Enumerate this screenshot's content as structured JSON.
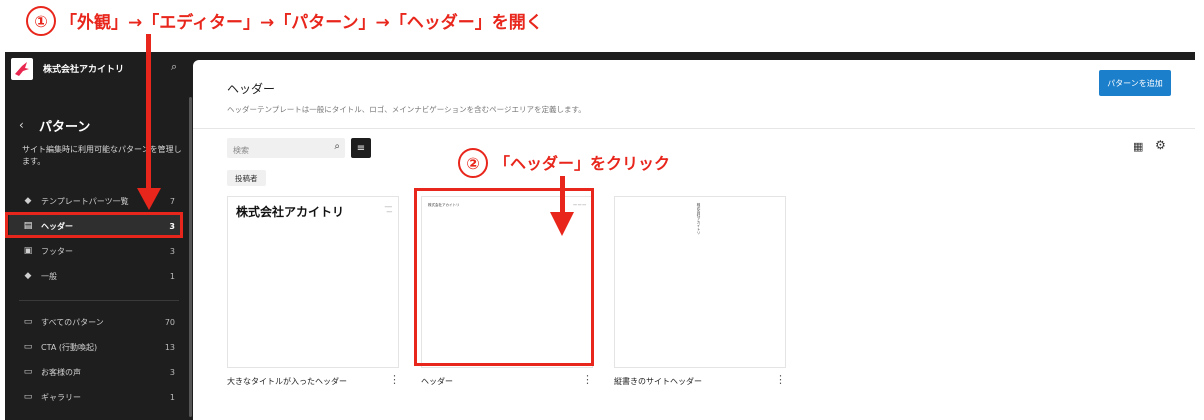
{
  "annotations": {
    "step1_number": "①",
    "step1_text": "「外観」→「エディター」→「パターン」→「ヘッダー」を開く",
    "step2_number": "②",
    "step2_text": "「ヘッダー」をクリック"
  },
  "sidebar": {
    "site_name": "株式会社アカイトリ",
    "title": "パターン",
    "description": "サイト編集時に利用可能なパターンを管理します。",
    "items": [
      {
        "label": "テンプレートパーツ一覧",
        "count": "7",
        "icon": "template-parts-icon"
      },
      {
        "label": "ヘッダー",
        "count": "3",
        "icon": "header-icon",
        "active": true
      },
      {
        "label": "フッター",
        "count": "3",
        "icon": "footer-icon"
      },
      {
        "label": "一般",
        "count": "1",
        "icon": "general-icon"
      }
    ],
    "categories": [
      {
        "label": "すべてのパターン",
        "count": "70"
      },
      {
        "label": "CTA (行動喚起)",
        "count": "13"
      },
      {
        "label": "お客様の声",
        "count": "3"
      },
      {
        "label": "ギャラリー",
        "count": "1"
      }
    ]
  },
  "main": {
    "title": "ヘッダー",
    "description": "ヘッダーテンプレートは一般にタイトル、ロゴ、メインナビゲーションを含むページエリアを定義します。",
    "add_button": "パターンを追加",
    "search_placeholder": "検索",
    "filter_chip": "投稿者",
    "patterns": [
      {
        "label": "大きなタイトルが入ったヘッダー",
        "preview_title": "株式会社アカイトリ"
      },
      {
        "label": "ヘッダー",
        "preview_title": "株式会社アカイトリ"
      },
      {
        "label": "縦書きのサイトヘッダー",
        "preview_title": "株式会社アカイトリ"
      }
    ]
  },
  "colors": {
    "annotation_red": "#e8261c",
    "sidebar_bg": "#1e1e1e",
    "accent_blue": "#1b7fcc"
  }
}
